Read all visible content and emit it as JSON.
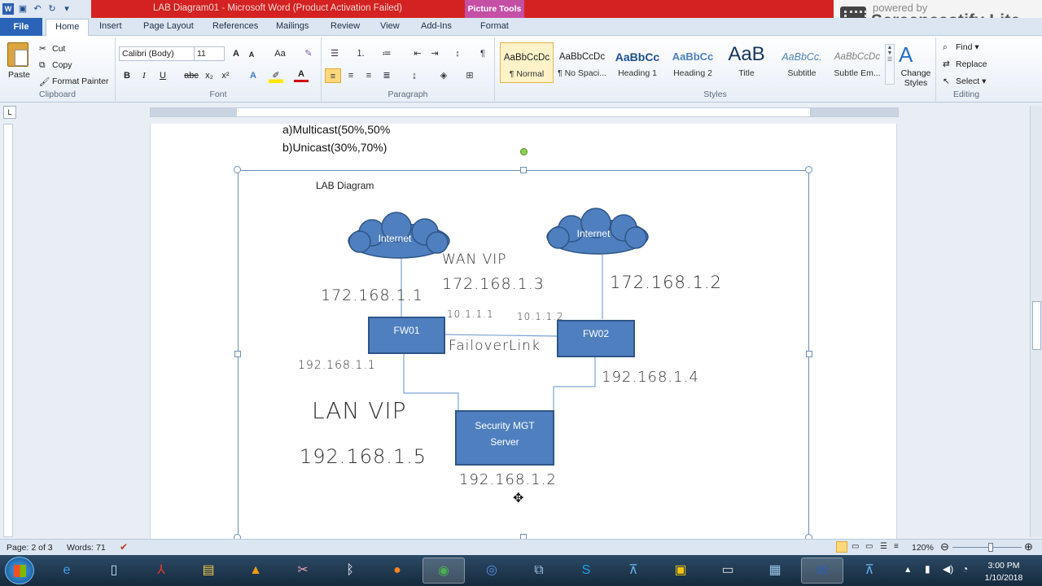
{
  "window": {
    "title": "LAB Diagram01  -  Microsoft Word (Product Activation Failed)",
    "context_tab_group": "Picture Tools",
    "word_icon": "W"
  },
  "watermark": {
    "powered": "powered by",
    "name": "Screencastify Lite"
  },
  "tabs": {
    "file": "File",
    "home": "Home",
    "insert": "Insert",
    "page_layout": "Page Layout",
    "references": "References",
    "mailings": "Mailings",
    "review": "Review",
    "view": "View",
    "addins": "Add-Ins",
    "format": "Format"
  },
  "clipboard": {
    "paste": "Paste",
    "cut": "Cut",
    "copy": "Copy",
    "format_painter": "Format Painter",
    "label": "Clipboard"
  },
  "font": {
    "name": "Calibri (Body)",
    "size": "11",
    "label": "Font",
    "bold": "B",
    "italic": "I",
    "underline": "U",
    "strike": "abc",
    "sub": "x₂",
    "sup": "x²",
    "case": "Aa",
    "grow": "A",
    "shrink": "A"
  },
  "paragraph": {
    "label": "Paragraph"
  },
  "styles": {
    "label": "Styles",
    "items": [
      {
        "sample": "AaBbCcDc",
        "name": "¶ Normal"
      },
      {
        "sample": "AaBbCcDc",
        "name": "¶ No Spaci..."
      },
      {
        "sample": "AaBbCc",
        "name": "Heading 1"
      },
      {
        "sample": "AaBbCc",
        "name": "Heading 2"
      },
      {
        "sample": "AaB",
        "name": "Title"
      },
      {
        "sample": "AaBbCc.",
        "name": "Subtitle"
      },
      {
        "sample": "AaBbCcDc",
        "name": "Subtle Em..."
      }
    ],
    "change": "Change Styles"
  },
  "editing": {
    "label": "Editing",
    "find": "Find",
    "replace": "Replace",
    "select": "Select"
  },
  "document": {
    "option_a": "a)Multicast(50%,50%",
    "option_b": "b)Unicast(30%,70%)"
  },
  "diagram": {
    "title": "LAB Diagram",
    "cloud_left": "Internet",
    "cloud_right": "Internet",
    "fw01": "FW01",
    "fw02": "FW02",
    "server": "Security MGT Server",
    "notes": {
      "wan_vip": "WAN VIP",
      "wan_ip": "172.168.1.3",
      "left_wan": "172.168.1.1",
      "right_wan": "172.168.1.2",
      "link_left": "10.1.1.1",
      "link_right": "10.1.1.2",
      "failover": "FailoverLink",
      "lan_left": "192.168.1.1",
      "lan_right": "192.168.1.4",
      "lan_vip": "LAN VIP",
      "lan_vip_ip": "192.168.1.5",
      "server_ip": "192.168.1.2"
    }
  },
  "status": {
    "page": "Page: 2 of 3",
    "words": "Words: 71",
    "zoom": "120%"
  },
  "clock": {
    "time": "3:00 PM",
    "date": "1/10/2018"
  }
}
